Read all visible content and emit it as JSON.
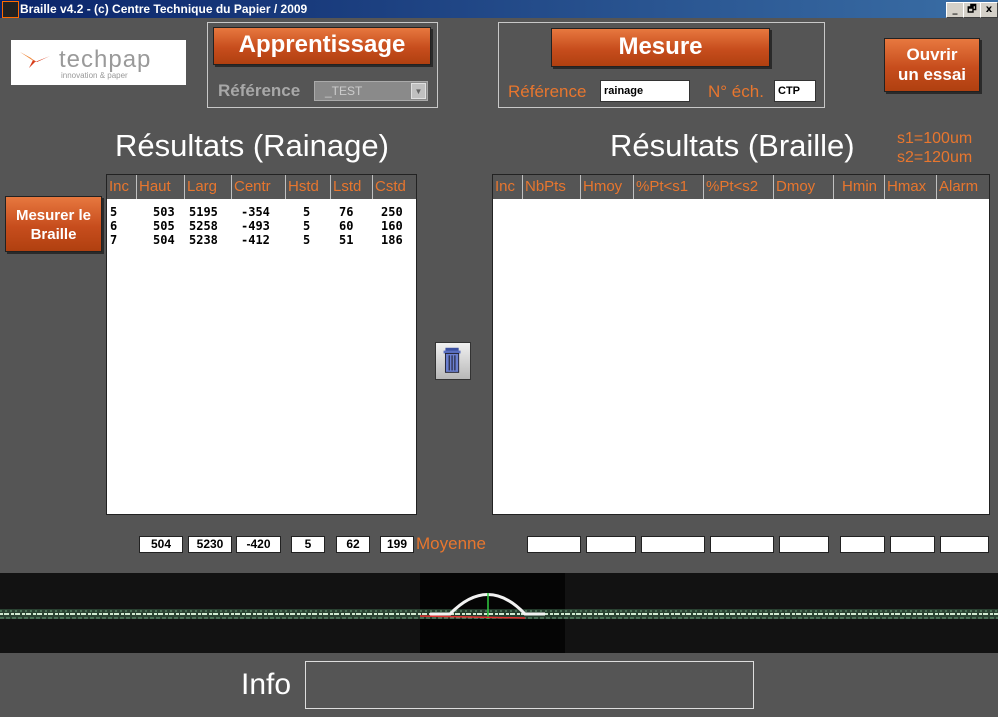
{
  "window": {
    "title": "Braille v4.2 - (c) Centre Technique du Papier / 2009",
    "controls": [
      "_",
      "🗗",
      "x"
    ]
  },
  "logo": {
    "brand": "techpap",
    "tagline": "innovation & paper"
  },
  "apprentissage": {
    "button": "Apprentissage",
    "reference_label": "Référence",
    "reference_value": "_TEST"
  },
  "mesure": {
    "button": "Mesure",
    "reference_label": "Référence",
    "reference_value": "rainage",
    "ech_label": "N° éch.",
    "ech_value": "CTP"
  },
  "ouvrir_button": {
    "line1": "Ouvrir",
    "line2": "un essai"
  },
  "mesurer_button": {
    "line1": "Mesurer le",
    "line2": "Braille"
  },
  "rainage": {
    "title": "Résultats (Rainage)",
    "columns": [
      "Inc",
      "Haut",
      "Larg",
      "Centr",
      "Hstd",
      "Lstd",
      "Cstd"
    ],
    "rows": [
      [
        "5",
        "503",
        "5195",
        "-354",
        "5",
        "76",
        "250"
      ],
      [
        "6",
        "505",
        "5258",
        "-493",
        "5",
        "60",
        "160"
      ],
      [
        "7",
        "504",
        "5238",
        "-412",
        "5",
        "51",
        "186"
      ]
    ],
    "averages": [
      "504",
      "5230",
      "-420",
      "5",
      "62",
      "199"
    ],
    "average_label": "Moyenne"
  },
  "braille": {
    "title": "Résultats (Braille)",
    "s1": "s1=100um",
    "s2": "s2=120um",
    "columns": [
      "Inc",
      "NbPts",
      "Hmoy",
      "%Pt<s1",
      "%Pt<s2",
      "Dmoy",
      "Hmin",
      "Hmax",
      "Alarm"
    ],
    "averages": [
      "",
      "",
      "",
      "",
      "",
      "",
      "",
      ""
    ]
  },
  "info": {
    "label": "Info",
    "value": ""
  },
  "colors": {
    "accent": "#e8762e",
    "background": "#555555"
  },
  "icons": {
    "trash": "trash-icon"
  }
}
